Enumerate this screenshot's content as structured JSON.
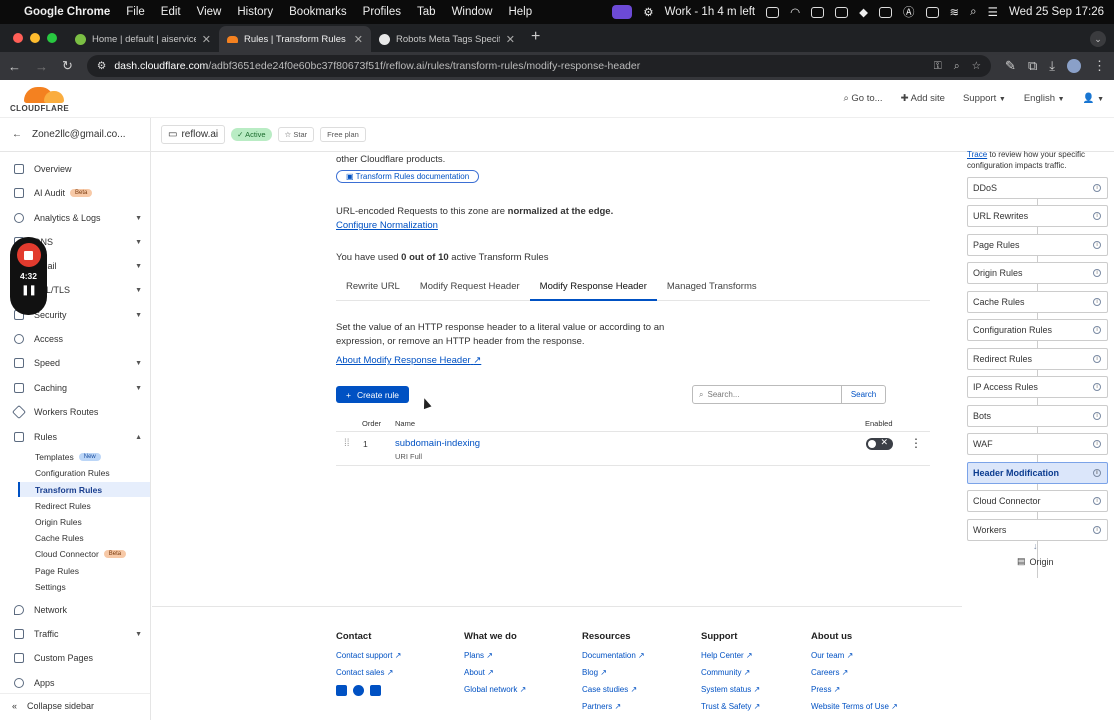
{
  "menubar": {
    "apple_icon": "apple-icon",
    "app": "Google Chrome",
    "menus": [
      "File",
      "Edit",
      "View",
      "History",
      "Bookmarks",
      "Profiles",
      "Tab",
      "Window",
      "Help"
    ],
    "work_status": "Work - 1h 4 m left",
    "datetime": "Wed 25 Sep  17:26"
  },
  "tabs": [
    {
      "title": "Home | default | aiservice-pr",
      "favicon_color": "#7bbf44",
      "active": false
    },
    {
      "title": "Rules | Transform Rules | Mo",
      "favicon_color": "#f48120",
      "active": true
    },
    {
      "title": "Robots Meta Tags Specificatio",
      "favicon_color": "#e8e8e8",
      "active": false
    }
  ],
  "address": {
    "host": "dash.cloudflare.com",
    "path": "/adbf3651ede24f0e60bc37f80673f51f/reflow.ai/rules/transform-rules/modify-response-header"
  },
  "cf_header": {
    "logo_text": "CLOUDFLARE",
    "goto": "Go to...",
    "add_site": "Add site",
    "support": "Support",
    "language": "English"
  },
  "account": {
    "email": "Zone2llc@gmail.co...",
    "zone": "reflow.ai",
    "status": "Active",
    "star": "Star",
    "plan": "Free plan"
  },
  "sidebar": {
    "items": [
      {
        "label": "Overview",
        "chevron": false
      },
      {
        "label": "AI Audit",
        "badge": "Beta",
        "chevron": false
      },
      {
        "label": "Analytics & Logs",
        "chevron": true
      },
      {
        "label": "DNS",
        "chevron": true
      },
      {
        "label": "Email",
        "chevron": true
      },
      {
        "label": "SSL/TLS",
        "chevron": true
      },
      {
        "label": "Security",
        "chevron": true
      },
      {
        "label": "Access",
        "chevron": false
      },
      {
        "label": "Speed",
        "chevron": true
      },
      {
        "label": "Caching",
        "chevron": true
      },
      {
        "label": "Workers Routes",
        "chevron": false
      },
      {
        "label": "Rules",
        "chevron": true
      }
    ],
    "sub_items": [
      {
        "label": "Templates",
        "badge": "New"
      },
      {
        "label": "Configuration Rules"
      },
      {
        "label": "Transform Rules",
        "selected": true
      },
      {
        "label": "Redirect Rules"
      },
      {
        "label": "Origin Rules"
      },
      {
        "label": "Cache Rules"
      },
      {
        "label": "Cloud Connector",
        "badge": "Beta"
      },
      {
        "label": "Page Rules"
      },
      {
        "label": "Settings"
      }
    ],
    "bottom_items": [
      {
        "label": "Network",
        "chevron": false
      },
      {
        "label": "Traffic",
        "chevron": true
      },
      {
        "label": "Custom Pages",
        "chevron": false
      },
      {
        "label": "Apps",
        "chevron": false
      }
    ],
    "collapse": "Collapse sidebar"
  },
  "recorder": {
    "time": "4:32"
  },
  "main": {
    "intro_tail": "other Cloudflare products.",
    "doc_button": "Transform Rules documentation",
    "normalized_prefix": "URL-encoded Requests to this zone are ",
    "normalized_bold": "normalized at the edge.",
    "configure_link": "Configure Normalization",
    "usage_prefix": "You have used ",
    "usage_bold": "0 out of 10",
    "usage_suffix": " active Transform Rules",
    "tabs": [
      "Rewrite URL",
      "Modify Request Header",
      "Modify Response Header",
      "Managed Transforms"
    ],
    "desc_line1": "Set the value of an HTTP response header to a literal value or according to an",
    "desc_line2": "expression, or remove an HTTP header from the response.",
    "about_link": "About Modify Response Header",
    "create_rule": "Create rule",
    "search_placeholder": "Search...",
    "search_button": "Search",
    "columns": {
      "order": "Order",
      "name": "Name",
      "enabled": "Enabled"
    },
    "rules": [
      {
        "order": "1",
        "name": "subdomain-indexing",
        "detail": "URI Full",
        "enabled": false
      }
    ]
  },
  "footer": {
    "columns": [
      {
        "heading": "Contact",
        "links": [
          "Contact support",
          "Contact sales"
        ]
      },
      {
        "heading": "What we do",
        "links": [
          "Plans",
          "About",
          "Global network"
        ]
      },
      {
        "heading": "Resources",
        "links": [
          "Documentation",
          "Blog",
          "Case studies",
          "Partners"
        ]
      },
      {
        "heading": "Support",
        "links": [
          "Help Center",
          "Community",
          "System status",
          "Trust & Safety"
        ]
      },
      {
        "heading": "About us",
        "links": [
          "Our team",
          "Careers",
          "Press",
          "Website Terms of Use"
        ]
      }
    ]
  },
  "rail": {
    "intro_link": "Trace",
    "intro_text": " to review how your specific configuration impacts traffic.",
    "steps": [
      "DDoS",
      "URL Rewrites",
      "Page Rules",
      "Origin Rules",
      "Cache Rules",
      "Configuration Rules",
      "Redirect Rules",
      "IP Access Rules",
      "Bots",
      "WAF",
      "Header Modification",
      "Cloud Connector",
      "Workers"
    ],
    "selected_step": "Header Modification",
    "origin": "Origin"
  }
}
